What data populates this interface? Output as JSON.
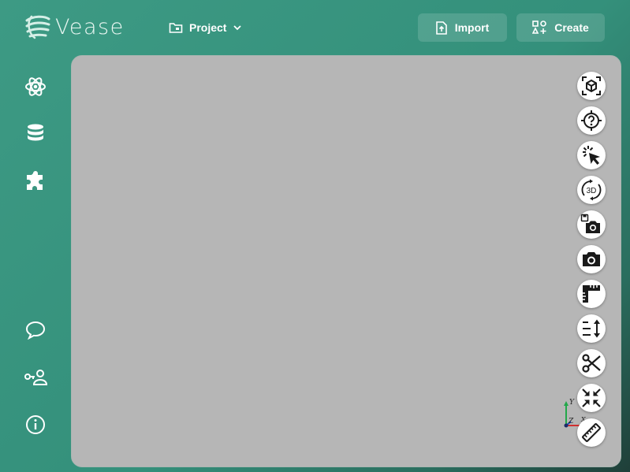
{
  "app": {
    "name": "Vease"
  },
  "header": {
    "project_label": "Project",
    "import_label": "Import",
    "create_label": "Create"
  },
  "sidebar": {
    "top_items": [
      "atom-icon",
      "database-icon",
      "puzzle-icon"
    ],
    "bottom_items": [
      "chat-icon",
      "user-key-icon",
      "info-icon"
    ]
  },
  "viewport": {
    "background": "#b6b6b6"
  },
  "toolbar": {
    "tools": [
      "reset-camera",
      "picking-help",
      "point-picking",
      "3d-rotate",
      "save-screenshot",
      "screenshot",
      "ruler-vertical",
      "z-scaling",
      "clipping",
      "shrink",
      "measure"
    ],
    "rotate_label": "3D"
  },
  "axes": {
    "y_label": "Y",
    "z_label": "Z",
    "x_label": "X"
  },
  "colors": {
    "accent": "#3d9a84",
    "icon": "#1a1a1a"
  }
}
